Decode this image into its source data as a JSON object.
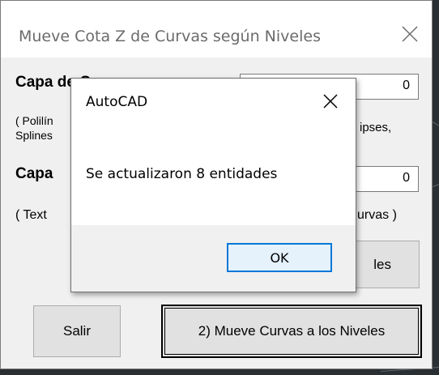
{
  "main_dialog": {
    "title": "Mueve Cota Z de Curvas según Niveles",
    "layer_curves_label": "Capa de Curvas",
    "layer_curves_value": "0",
    "curves_hint_left": "( Polilín",
    "curves_hint_left2": "Splines",
    "curves_hint_right": "ipses,",
    "layer_levels_label": "Capa",
    "layer_levels_value": "0",
    "levels_hint_left": "( Text",
    "levels_hint_right": "urvas )",
    "step1_button_partial": "les",
    "exit_button": "Salir",
    "move_button": "2) Mueve Curvas a los Niveles"
  },
  "message_box": {
    "title": "AutoCAD",
    "message": "Se actualizaron 8 entidades",
    "ok_button": "OK"
  }
}
